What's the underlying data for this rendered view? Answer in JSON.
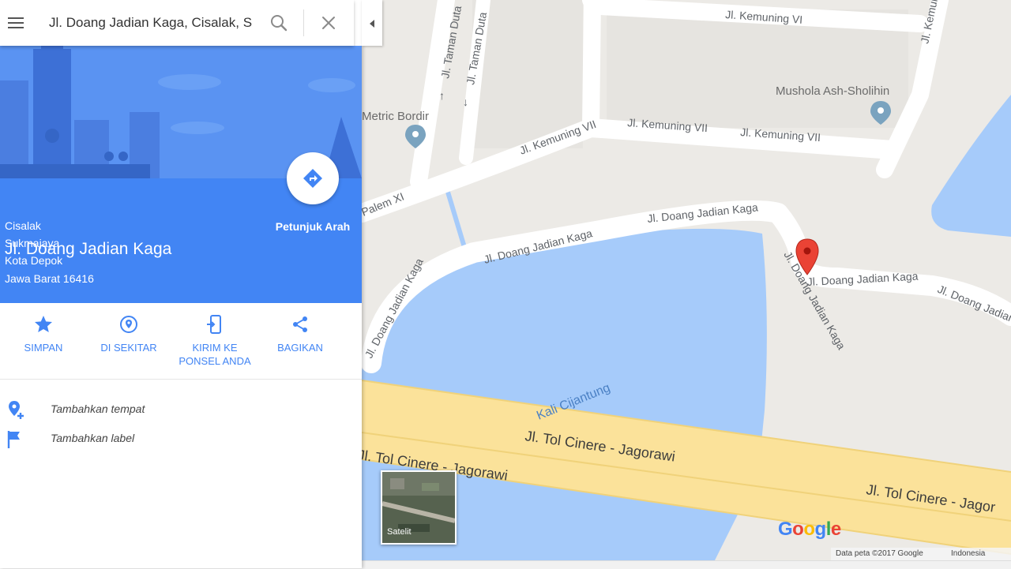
{
  "search": {
    "value": "Jl. Doang Jadian Kaga, Cisalak, S"
  },
  "place": {
    "title": "Jl. Doang Jadian Kaga",
    "address_lines": [
      "Cisalak",
      "Sukmajaya",
      "Kota Depok",
      "Jawa Barat 16416"
    ],
    "directions_label": "Petunjuk Arah"
  },
  "actions": [
    {
      "label": "SIMPAN",
      "icon": "star-icon"
    },
    {
      "label": "DI SEKITAR",
      "icon": "nearby-pin-icon"
    },
    {
      "label": "KIRIM KE PONSEL ANDA",
      "icon": "send-to-phone-icon"
    },
    {
      "label": "BAGIKAN",
      "icon": "share-icon"
    }
  ],
  "extras": [
    {
      "label": "Tambahkan tempat",
      "icon": "add-place-icon"
    },
    {
      "label": "Tambahkan label",
      "icon": "flag-icon"
    }
  ],
  "map": {
    "street_labels": {
      "kemuning_vi": "Jl. Kemuning VI",
      "taman_duta_1": "Jl. Taman Duta",
      "taman_duta_2": "Jl. Taman Duta",
      "kemuning_vii_1": "Jl. Kemuning VII",
      "kemuning_vii_2": "Jl. Kemuning VII",
      "kemuning_vii_3": "Jl. Kemuning VII",
      "palem_xi": "Palem XI",
      "doang_1": "Jl. Doang Jadian Kaga",
      "doang_2": "Jl. Doang Jadian Kaga",
      "doang_3": "Jl. Doang Jadian Kaga",
      "doang_4": "Jl. Doang Jadian Kaga",
      "doang_5": "Jl. Doang Jadian Kaga",
      "doang_6": "Jl. Doang Jadian Kaga",
      "tol_1": "Jl. Tol Cinere - Jagorawi",
      "tol_2": "Jl. Tol Cinere - Jagorawi",
      "tol_3": "Jl. Tol Cinere - Jagor",
      "top_right": "Jl. Kemuning"
    },
    "poi": {
      "mushola": "Mushola Ash-Sholihin",
      "metric_bordir": "Metric Bordir"
    },
    "water": {
      "kali": "Kali Cijantung"
    },
    "satellite_label": "Satelit",
    "attribution": {
      "data": "Data peta ©2017 Google",
      "region": "Indonesia"
    },
    "google_logo": [
      "G",
      "o",
      "o",
      "g",
      "l",
      "e"
    ],
    "colors": {
      "land": "#eceae6",
      "water": "#a6cbfa",
      "road": "#ffffff",
      "toll": "#fbe29a",
      "toll_border": "#f0d27a",
      "marker": "#ea4335",
      "accent": "#4285f4"
    }
  }
}
